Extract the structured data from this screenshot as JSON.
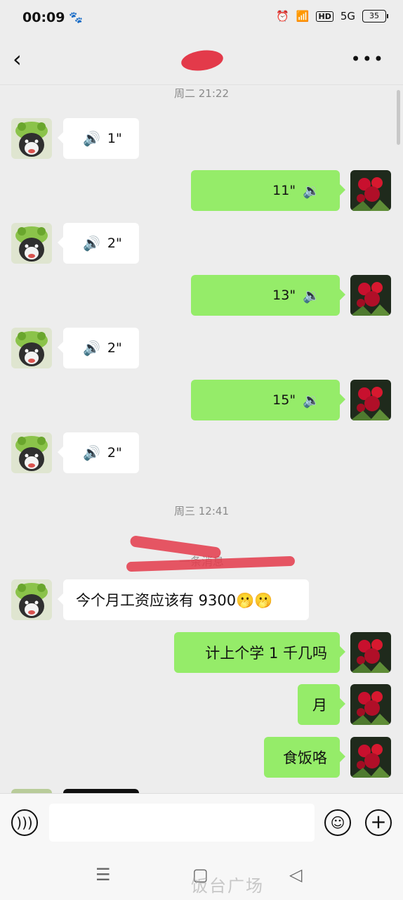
{
  "status_bar": {
    "time": "00:09",
    "network": "5G",
    "hd_label": "HD",
    "battery": "35"
  },
  "header": {
    "title": "",
    "back_icon": "back-arrow-icon",
    "more_icon": "more-icon"
  },
  "chat": {
    "timestamps": [
      "周二 21:22",
      "周三 12:41"
    ],
    "voice_messages": [
      {
        "from": "in",
        "duration": "1\""
      },
      {
        "from": "out",
        "duration": "11\""
      },
      {
        "from": "in",
        "duration": "2\""
      },
      {
        "from": "out",
        "duration": "13\""
      },
      {
        "from": "in",
        "duration": "2\""
      },
      {
        "from": "out",
        "duration": "15\""
      },
      {
        "from": "in",
        "duration": "2\""
      }
    ],
    "recall_notice": "一条消息",
    "text_messages": [
      {
        "from": "in",
        "text": "今个月工资应该有 9300🫢🫢"
      },
      {
        "from": "out",
        "text": "计上个学 1 千几吗"
      },
      {
        "from": "out",
        "text": "月"
      },
      {
        "from": "out",
        "text": "食饭咯"
      }
    ]
  },
  "input_bar": {
    "placeholder": "",
    "icons": [
      "voice-input-icon",
      "emoji-icon",
      "plus-icon"
    ]
  },
  "system_nav": {
    "watermark": "饭台广场"
  },
  "colors": {
    "background": "#ededed",
    "incoming_bubble": "#ffffff",
    "outgoing_bubble": "#95ec69",
    "redaction": "#e33a4a"
  }
}
